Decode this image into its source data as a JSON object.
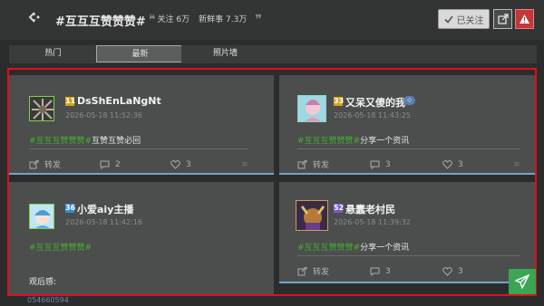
{
  "header": {
    "back_glyph": "<·",
    "title": "#互互互赞赞赞#",
    "followers": "关注 6万",
    "fresh": "新鲜事 7.3万",
    "follow_label": "已关注"
  },
  "tabs": [
    "热门",
    "最新",
    "照片墙"
  ],
  "posts": [
    {
      "level": "11",
      "level_color": "#d6a21a",
      "name": "DsShEnLaNgNt",
      "time": "2026-05-18 11:52:36",
      "tag": "#互互互赞赞赞#",
      "text": "互赞互赞必回",
      "forward": "转发",
      "comments": "2",
      "likes": "3"
    },
    {
      "level": "33",
      "level_color": "#d6a21a",
      "name": "又呆又傻的我",
      "time": "2026-05-18 11:43:25",
      "tag": "#互互互赞赞赞#",
      "text": "分享一个资讯",
      "forward": "转发",
      "comments": "3",
      "likes": "3"
    },
    {
      "level": "36",
      "level_color": "#2b8fd6",
      "name": "小爱aiy主播",
      "time": "2026-05-18 11:42:16",
      "tag": "#互互互赞赞赞#",
      "text": "",
      "extra": "观后感:"
    },
    {
      "level": "52",
      "level_color": "#7a56d0",
      "name": "悬蠢老村民",
      "time": "2026-05-18 11:39:32",
      "tag": "#互互互赞赞赞#",
      "text": "分享一个资讯",
      "forward": "转发",
      "comments": "3",
      "likes": "3"
    }
  ],
  "footer_peek": "054660594"
}
